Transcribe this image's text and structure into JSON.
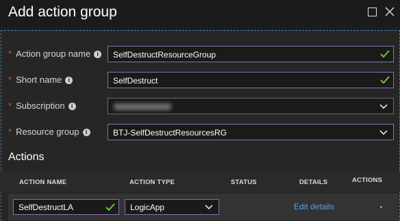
{
  "window": {
    "title": "Add action group"
  },
  "form": {
    "action_group_name": {
      "label": "Action group name",
      "value": "SelfDestructResourceGroup"
    },
    "short_name": {
      "label": "Short name",
      "value": "SelfDestruct"
    },
    "subscription": {
      "label": "Subscription"
    },
    "resource_group": {
      "label": "Resource group",
      "value": "BTJ-SelfDestructResourcesRG"
    }
  },
  "actions": {
    "heading": "Actions",
    "columns": [
      "ACTION NAME",
      "ACTION TYPE",
      "STATUS",
      "DETAILS",
      "ACTIONS"
    ],
    "rows": [
      {
        "action_name": "SelfDestructLA",
        "action_type": "LogicApp",
        "details_link": "Edit details"
      }
    ]
  },
  "icons": {
    "info": "info-icon",
    "valid": "checkmark-icon",
    "dropdown": "chevron-down-icon",
    "close": "close-icon",
    "maximize": "maximize-icon"
  },
  "colors": {
    "required": "#e8413c",
    "focus_border": "#8e6cb7",
    "valid": "#6cc24a",
    "link": "#5d9ee8"
  }
}
